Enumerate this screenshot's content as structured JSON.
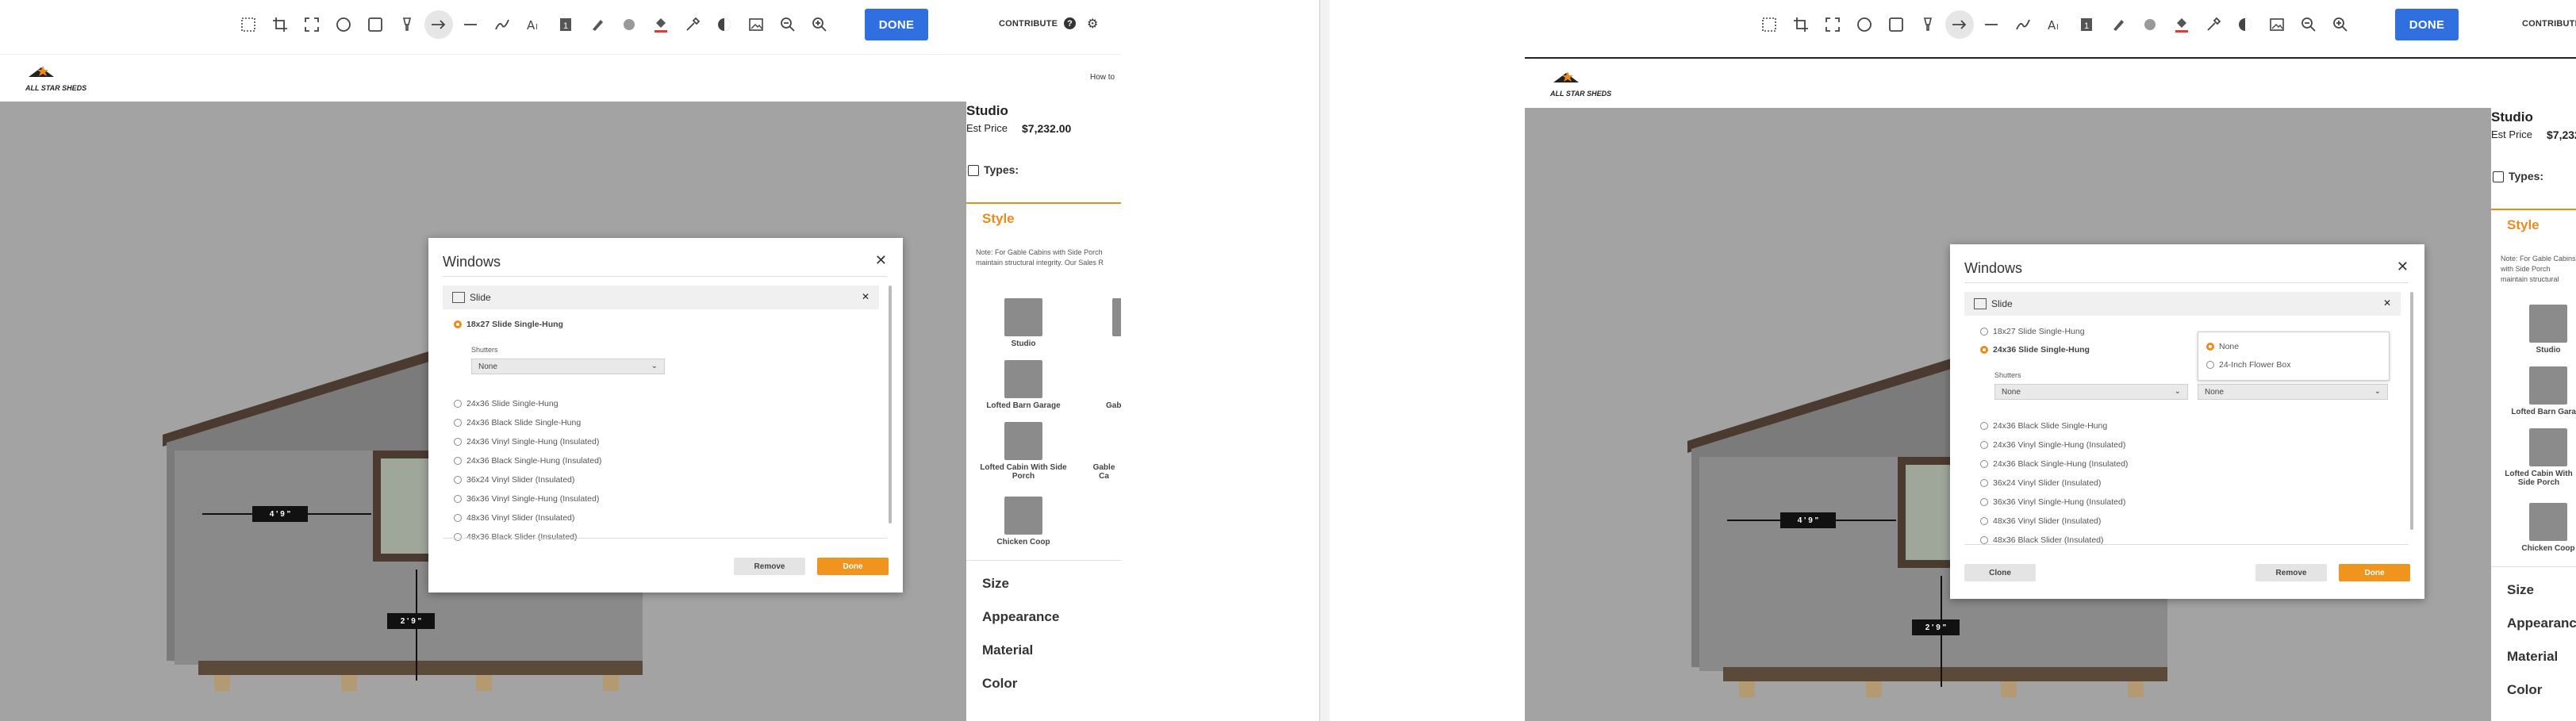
{
  "colors": {
    "accent": "#2f6fe0",
    "orange": "#ee8a1c",
    "overlay": "#a3a3a3"
  },
  "toolbar": {
    "tools": [
      "select-rect-icon",
      "crop-icon",
      "expand-icon",
      "circle-icon",
      "square-icon",
      "highlighter-icon",
      "arrow-icon",
      "line-icon",
      "pen-icon",
      "text-icon",
      "number-icon",
      "marker-icon",
      "blur-icon",
      "fill-icon",
      "eyedropper-icon",
      "contrast-icon",
      "image-icon",
      "zoom-out-icon",
      "zoom-in-icon"
    ],
    "done_label": "DONE",
    "contribute_label": "CONTRIBUTE"
  },
  "site": {
    "logo_text": "ALL STAR SHEDS",
    "how_to": "How to",
    "product_name": "Studio",
    "est_price_label": "Est Price",
    "est_price_value": "$7,232.00",
    "types_label": "Types:",
    "style_label": "Style",
    "style_note": "Note: For Gable Cabins with Side Porch maintain structural integrity. Our Sales R",
    "style_items": [
      "Studio",
      "Lofted Barn Garage",
      "Lofted Cabin With Side Porch",
      "Chicken Coop",
      "Gab",
      "Gable Ca"
    ],
    "sections": [
      "Size",
      "Appearance",
      "Material",
      "Color"
    ],
    "dims": [
      "4 ' 9 \"",
      "2 ' 9 \""
    ]
  },
  "left_modal": {
    "title": "Windows",
    "sub_title": "Slide",
    "selected": "18x27 Slide Single-Hung",
    "shutters_label": "Shutters",
    "shutters_value": "None",
    "options": [
      "24x36 Slide Single-Hung",
      "24x36 Black Slide Single-Hung",
      "24x36 Vinyl Single-Hung (Insulated)",
      "24x36 Black Single-Hung (Insulated)",
      "36x24 Vinyl Slider (Insulated)",
      "36x36 Vinyl Single-Hung (Insulated)",
      "48x36 Vinyl Slider (Insulated)",
      "48x36 Black Slider (Insulated)"
    ],
    "remove_label": "Remove",
    "done_label": "Done"
  },
  "right_modal": {
    "title": "Windows",
    "sub_title": "Slide",
    "first_option": "18x27 Slide Single-Hung",
    "selected": "24x36 Slide Single-Hung",
    "shutters_label": "Shutters",
    "shutters_value": "None",
    "flower_value": "None",
    "flower_options": [
      "None",
      "24-Inch Flower Box"
    ],
    "options": [
      "24x36 Black Slide Single-Hung",
      "24x36 Vinyl Single-Hung (Insulated)",
      "24x36 Black Single-Hung (Insulated)",
      "36x24 Vinyl Slider (Insulated)",
      "36x36 Vinyl Single-Hung (Insulated)",
      "48x36 Vinyl Slider (Insulated)",
      "48x36 Black Slider (Insulated)"
    ],
    "clone_label": "Clone",
    "remove_label": "Remove",
    "done_label": "Done"
  }
}
